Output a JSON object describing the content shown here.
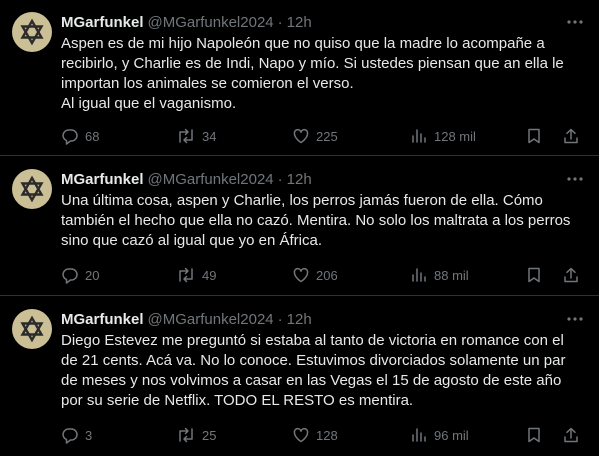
{
  "tweets": [
    {
      "name": "MGarfunkel",
      "handle": "@MGarfunkel2024",
      "time": "12h",
      "text": "Aspen es de mi hijo Napoleón que no quiso que la madre lo acompañe a recibirlo, y Charlie es de Indi, Napo y mío. Si ustedes piensan que an ella le importan los animales se comieron el verso.\nAl igual que el vaganismo.",
      "replies": "68",
      "reposts": "34",
      "likes": "225",
      "views": "128 mil"
    },
    {
      "name": "MGarfunkel",
      "handle": "@MGarfunkel2024",
      "time": "12h",
      "text": "Una última cosa, aspen y Charlie, los perros jamás fueron de ella. Cómo también el hecho que ella no cazó. Mentira. No solo los maltrata a los perros sino que cazó al igual que yo en África.",
      "replies": "20",
      "reposts": "49",
      "likes": "206",
      "views": "88 mil"
    },
    {
      "name": "MGarfunkel",
      "handle": "@MGarfunkel2024",
      "time": "12h",
      "text": "Diego Estevez me preguntó si estaba al tanto de victoria en romance con el de 21 cents. Acá va. No lo conoce. Estuvimos divorciados solamente un par de meses y nos volvimos a casar en las Vegas el 15 de agosto de este año por su serie de Netflix. TODO EL RESTO es mentira.",
      "replies": "3",
      "reposts": "25",
      "likes": "128",
      "views": "96 mil"
    }
  ],
  "separator": "·",
  "icons": {
    "avatar": "star-of-david-icon",
    "more": "more-dots-icon",
    "reply": "reply-bubble-icon",
    "repost": "repost-arrows-icon",
    "like": "heart-icon",
    "views": "views-bars-icon",
    "bookmark": "bookmark-icon",
    "share": "share-upload-icon"
  },
  "colors": {
    "background": "#000000",
    "text": "#e7e9ea",
    "muted": "#71767b",
    "divider": "#2f3336",
    "avatar_bg": "#cbbf95"
  }
}
